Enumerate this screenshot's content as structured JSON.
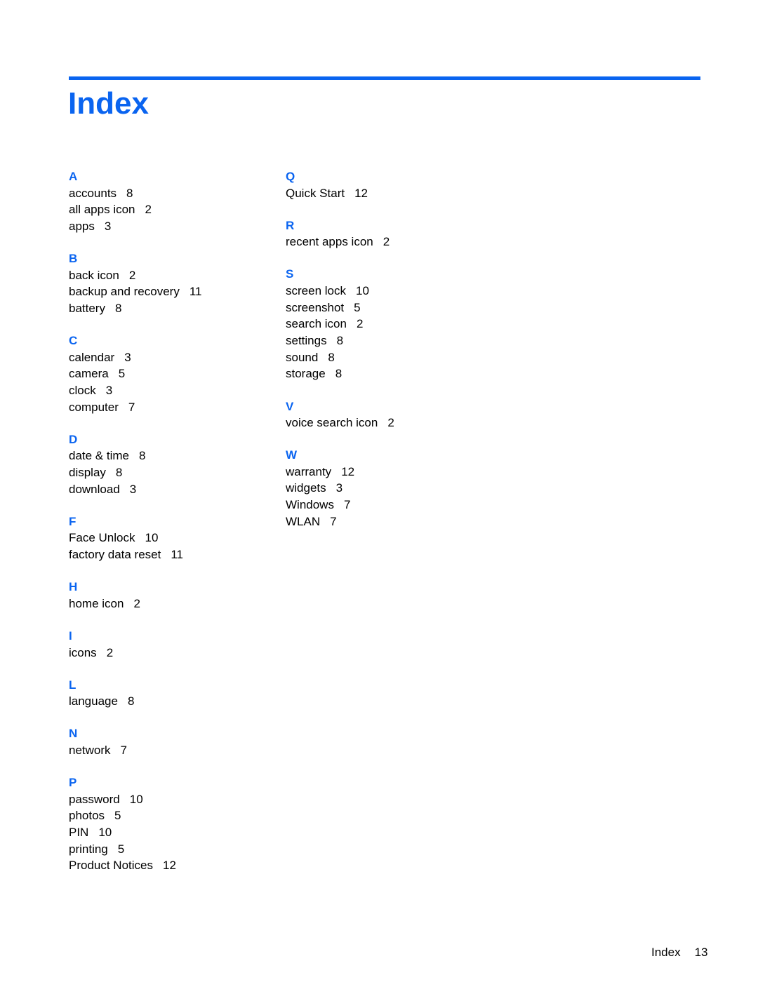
{
  "title": "Index",
  "colors": {
    "accent": "#0a64f0"
  },
  "columns": [
    [
      {
        "letter": "A",
        "entries": [
          {
            "term": "accounts",
            "page": "8"
          },
          {
            "term": "all apps icon",
            "page": "2"
          },
          {
            "term": "apps",
            "page": "3"
          }
        ]
      },
      {
        "letter": "B",
        "entries": [
          {
            "term": "back icon",
            "page": "2"
          },
          {
            "term": "backup and recovery",
            "page": "11"
          },
          {
            "term": "battery",
            "page": "8"
          }
        ]
      },
      {
        "letter": "C",
        "entries": [
          {
            "term": "calendar",
            "page": "3"
          },
          {
            "term": "camera",
            "page": "5"
          },
          {
            "term": "clock",
            "page": "3"
          },
          {
            "term": "computer",
            "page": "7"
          }
        ]
      },
      {
        "letter": "D",
        "entries": [
          {
            "term": "date & time",
            "page": "8"
          },
          {
            "term": "display",
            "page": "8"
          },
          {
            "term": "download",
            "page": "3"
          }
        ]
      },
      {
        "letter": "F",
        "entries": [
          {
            "term": "Face Unlock",
            "page": "10"
          },
          {
            "term": "factory data reset",
            "page": "11"
          }
        ]
      },
      {
        "letter": "H",
        "entries": [
          {
            "term": "home icon",
            "page": "2"
          }
        ]
      },
      {
        "letter": "I",
        "entries": [
          {
            "term": "icons",
            "page": "2"
          }
        ]
      },
      {
        "letter": "L",
        "entries": [
          {
            "term": "language",
            "page": "8"
          }
        ]
      },
      {
        "letter": "N",
        "entries": [
          {
            "term": "network",
            "page": "7"
          }
        ]
      },
      {
        "letter": "P",
        "entries": [
          {
            "term": "password",
            "page": "10"
          },
          {
            "term": "photos",
            "page": "5"
          },
          {
            "term": "PIN",
            "page": "10"
          },
          {
            "term": "printing",
            "page": "5"
          },
          {
            "term": "Product Notices",
            "page": "12"
          }
        ]
      }
    ],
    [
      {
        "letter": "Q",
        "entries": [
          {
            "term": "Quick Start",
            "page": "12"
          }
        ]
      },
      {
        "letter": "R",
        "entries": [
          {
            "term": "recent apps icon",
            "page": "2"
          }
        ]
      },
      {
        "letter": "S",
        "entries": [
          {
            "term": "screen lock",
            "page": "10"
          },
          {
            "term": "screenshot",
            "page": "5"
          },
          {
            "term": "search icon",
            "page": "2"
          },
          {
            "term": "settings",
            "page": "8"
          },
          {
            "term": "sound",
            "page": "8"
          },
          {
            "term": "storage",
            "page": "8"
          }
        ]
      },
      {
        "letter": "V",
        "entries": [
          {
            "term": "voice search icon",
            "page": "2"
          }
        ]
      },
      {
        "letter": "W",
        "entries": [
          {
            "term": "warranty",
            "page": "12"
          },
          {
            "term": "widgets",
            "page": "3"
          },
          {
            "term": "Windows",
            "page": "7"
          },
          {
            "term": "WLAN",
            "page": "7"
          }
        ]
      }
    ]
  ],
  "footer": {
    "label": "Index",
    "page_number": "13"
  }
}
